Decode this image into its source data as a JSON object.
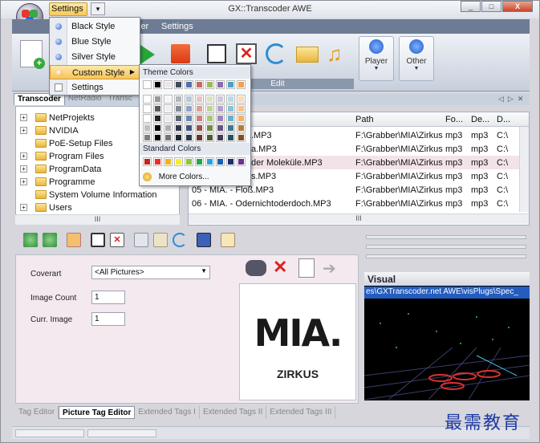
{
  "window": {
    "title": "GX::Transcoder AWE",
    "buttons": [
      "_",
      "□",
      "X"
    ]
  },
  "quick_access": {
    "settings_label": "Settings",
    "dropdown_glyph": "▾"
  },
  "ribbon": {
    "tabs": [
      "ler",
      "Settings"
    ],
    "group_edit_label": "Edit",
    "player_label": "Player",
    "other_label": "Other"
  },
  "settings_menu": {
    "items": [
      {
        "label": "Black Style"
      },
      {
        "label": "Blue Style"
      },
      {
        "label": "Silver Style"
      },
      {
        "label": "Custom Style"
      },
      {
        "label": "Settings"
      }
    ]
  },
  "color_palette": {
    "theme_header": "Theme Colors",
    "standard_header": "Standard Colors",
    "more_colors": "More Colors...",
    "theme_top_row": [
      "#ffffff",
      "#000000",
      "#e9e4ee",
      "#3e4b5c",
      "#5272a6",
      "#c76b5e",
      "#9cba5c",
      "#8a6db0",
      "#4aa3c0",
      "#f3a24e"
    ],
    "standard_row": [
      "#c0241e",
      "#ee2b2b",
      "#f2b21d",
      "#f5ee2c",
      "#8bc43f",
      "#22a84a",
      "#2aa3d8",
      "#1b5fb3",
      "#1f2f6b",
      "#6b2f95"
    ]
  },
  "left_panel": {
    "tabs": [
      "Transcoder",
      "NetRadio",
      "Transc"
    ],
    "tree": [
      "NetProjekts",
      "NVIDIA",
      "PoE-Setup Files",
      "Program Files",
      "ProgramData",
      "Programme",
      "System Volume Information",
      "Users"
    ],
    "scroll_glyph": "III"
  },
  "file_grid": {
    "columns": [
      "Path",
      "Fo...",
      "De...",
      "D..."
    ],
    "rows": [
      {
        "name": ".MP3",
        "path": "F:\\Grabber\\MIA\\Zirkus",
        "fo": "mp3",
        "de": "mp3",
        "d": "C:\\"
      },
      {
        "name": "a.MP3",
        "path": "F:\\Grabber\\MIA\\Zirkus",
        "fo": "mp3",
        "de": "mp3",
        "d": "C:\\"
      },
      {
        "name": "der Moleküle.MP3",
        "path": "F:\\Grabber\\MIA\\Zirkus",
        "fo": "mp3",
        "de": "mp3",
        "d": "C:\\"
      },
      {
        "name": "s.MP3",
        "path": "F:\\Grabber\\MIA\\Zirkus",
        "fo": "mp3",
        "de": "mp3",
        "d": "C:\\"
      },
      {
        "name": "05 - MIA. - Floß.MP3",
        "path": "F:\\Grabber\\MIA\\Zirkus",
        "fo": "mp3",
        "de": "mp3",
        "d": "C:\\"
      },
      {
        "name": "06 - MIA. - Odernichtoderdoch.MP3",
        "path": "F:\\Grabber\\MIA\\Zirkus",
        "fo": "mp3",
        "de": "mp3",
        "d": "C:\\"
      }
    ],
    "scroll_glyph": "III",
    "pane_controls": [
      "◁",
      "▷",
      "✕"
    ]
  },
  "picture_editor": {
    "coverart_label": "Coverart",
    "coverart_value": "<All Pictures>",
    "image_count_label": "Image Count",
    "image_count_value": "1",
    "curr_image_label": "Curr. Image",
    "curr_image_value": "1",
    "album_art_text": "MIA.",
    "album_sub_text": "ZIRKUS"
  },
  "bottom_tabs": [
    "Tag Editor",
    "Picture Tag Editor",
    "Extended Tags I",
    "Extended Tags II",
    "Extended Tags III"
  ],
  "visual": {
    "title": "Visual",
    "path": "es\\GXTranscoder.net AWE\\visPlugs\\Spec_"
  },
  "watermark": "最需教育"
}
